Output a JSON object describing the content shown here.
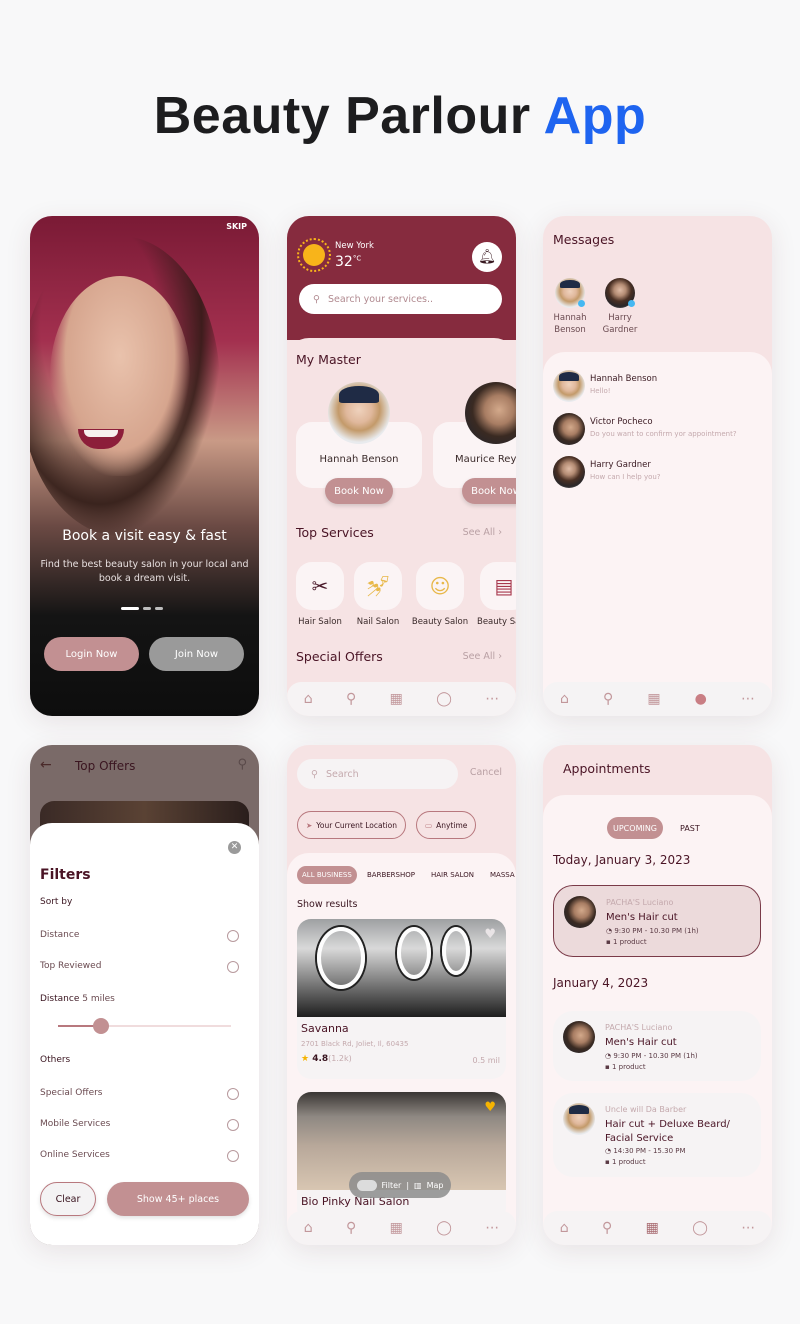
{
  "page": {
    "title_main": "Beauty Parlour ",
    "title_accent": "App"
  },
  "colors": {
    "accent_blue": "#1e64f0",
    "brand_maroon": "#862b3e",
    "rose": "#c29092",
    "blush_bg": "#f6e3e4"
  },
  "onboarding": {
    "skip": "SKIP",
    "headline": "Book a visit easy & fast",
    "subtext": "Find the best beauty salon in your local and book a dream visit.",
    "page_index": 1,
    "page_count": 3,
    "login": "Login Now",
    "join": "Join Now"
  },
  "home": {
    "weather": {
      "city": "New York",
      "temp": "32",
      "unit": "°C",
      "icon": "sun-icon"
    },
    "search_placeholder": "Search your services..",
    "my_master_title": "My Master",
    "masters": [
      {
        "name": "Hannah Benson",
        "button": "Book Now"
      },
      {
        "name": "Maurice Reyn",
        "button": "Book Now"
      }
    ],
    "top_services_title": "Top Services",
    "see_all": "See All",
    "services": [
      {
        "label": "Hair Salon",
        "icon": "scissors-comb-icon"
      },
      {
        "label": "Nail Salon",
        "icon": "nail-polish-icon"
      },
      {
        "label": "Beauty Salon",
        "icon": "makeup-face-icon"
      },
      {
        "label": "Beauty Sa",
        "icon": "beauty-case-icon"
      }
    ],
    "special_offers_title": "Special Offers",
    "see_all_2": "See All"
  },
  "messages": {
    "title": "Messages",
    "stories": [
      {
        "name": "Hannah Benson",
        "online": true
      },
      {
        "name": "Harry Gardner",
        "online": true
      }
    ],
    "threads": [
      {
        "name": "Hannah Benson",
        "preview": "Hello!"
      },
      {
        "name": "Victor Pocheco",
        "preview": "Do you want to confirm yor appointment?"
      },
      {
        "name": "Harry Gardner",
        "preview": "How can I help you?"
      }
    ]
  },
  "filters": {
    "screen_title": "Top Offers",
    "title": "Filters",
    "sort_by": "Sort by",
    "sort_options": [
      "Distance",
      "Top Reviewed"
    ],
    "distance_label": "Distance",
    "distance_value": "5 miles",
    "distance_fraction": 0.25,
    "others": "Others",
    "other_options": [
      "Special Offers",
      "Mobile Services",
      "Online Services"
    ],
    "clear": "Clear",
    "show": "Show 45+ places"
  },
  "search": {
    "placeholder": "Search",
    "cancel": "Cancel",
    "location_chip": "Your Current Location",
    "time_chip": "Anytime",
    "categories": [
      "ALL BUSINESS",
      "BARBERSHOP",
      "HAIR SALON",
      "MASSA"
    ],
    "active_category": 0,
    "results_title": "Show results",
    "results": [
      {
        "name": "Savanna",
        "address": "2701 Black Rd, Joliet, Il, 60435",
        "rating": "4.8",
        "reviews": "(1.2k)",
        "distance": "0.5 mil",
        "favorite": false
      },
      {
        "name": "Bio Pinky Nail Salon",
        "favorite": true
      }
    ],
    "filter_label": "Filter",
    "map_label": "Map"
  },
  "appointments": {
    "title": "Appointments",
    "tabs": [
      "UPCOMING",
      "PAST"
    ],
    "active_tab": 0,
    "groups": [
      {
        "date": "Today, January 3, 2023",
        "items": [
          {
            "shop": "PACHA'S Luciano",
            "service": "Men's Hair cut",
            "time": "9:30 PM - 10.30 PM (1h)",
            "products": "1 product",
            "selected": true
          }
        ]
      },
      {
        "date": "January 4, 2023",
        "items": [
          {
            "shop": "PACHA'S Luciano",
            "service": "Men's Hair cut",
            "time": "9:30 PM - 10.30 PM (1h)",
            "products": "1 product",
            "selected": false
          },
          {
            "shop": "Uncle will Da Barber",
            "service": "Hair cut + Deluxe Beard/ Facial Service",
            "time": "14:30 PM - 15.30 PM",
            "products": "1 product",
            "selected": false
          }
        ]
      }
    ]
  },
  "nav": {
    "items": [
      "home-icon",
      "search-icon",
      "calendar-icon",
      "chat-icon",
      "more-icon"
    ]
  }
}
